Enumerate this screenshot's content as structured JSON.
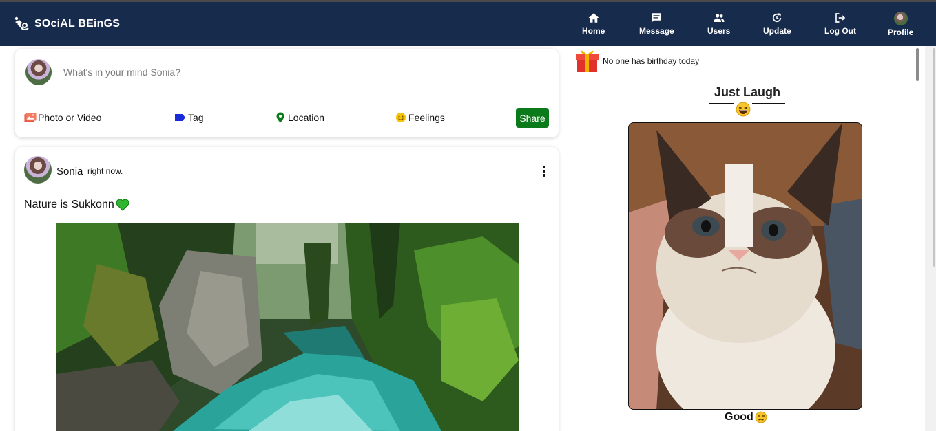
{
  "app": {
    "title": "SOciAL BEinGS"
  },
  "nav": {
    "items": [
      {
        "label": "Home",
        "icon": "home-icon"
      },
      {
        "label": "Message",
        "icon": "message-icon"
      },
      {
        "label": "Users",
        "icon": "users-icon"
      },
      {
        "label": "Update",
        "icon": "update-icon"
      },
      {
        "label": "Log Out",
        "icon": "logout-icon"
      },
      {
        "label": "Profile",
        "icon": "profile-avatar"
      }
    ]
  },
  "composer": {
    "placeholder": "What's in your mind Sonia?",
    "actions": [
      {
        "label": "Photo or Video",
        "icon": "photo-icon",
        "color": "#e8553e"
      },
      {
        "label": "Tag",
        "icon": "tag-icon",
        "color": "#1a2bd9"
      },
      {
        "label": "Location",
        "icon": "location-icon",
        "color": "#0b7a1a"
      },
      {
        "label": "Feelings",
        "icon": "smiley-icon",
        "color": "#f5c400"
      }
    ],
    "share_label": "Share"
  },
  "post": {
    "author": "Sonia",
    "time": "right now.",
    "text": "Nature is Sukkonn",
    "text_emoji": "green-heart-icon"
  },
  "sidebar": {
    "birthday_text": "No one has birthday today",
    "laugh_title": "Just Laugh",
    "laugh_emoji": "laughing-face-icon",
    "meme_caption": "Good",
    "meme_emoji": "unamused-face-icon"
  },
  "colors": {
    "navbar": "#172b4d",
    "share_button": "#0b7a1a"
  }
}
